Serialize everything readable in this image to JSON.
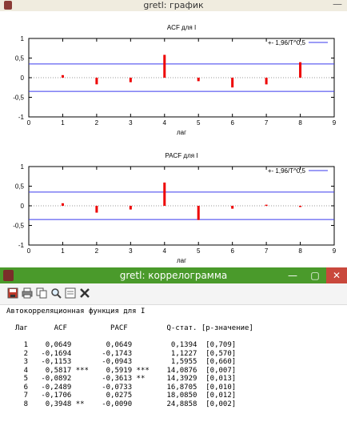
{
  "graph_window": {
    "title": "gretl: график"
  },
  "chart_data": [
    {
      "type": "bar",
      "title": "ACF для I",
      "xlabel": "лаг",
      "ylabel": "",
      "x": [
        1,
        2,
        3,
        4,
        5,
        6,
        7,
        8
      ],
      "values": [
        0.0649,
        -0.1694,
        -0.1153,
        0.5817,
        -0.0892,
        -0.2489,
        -0.1706,
        0.3948
      ],
      "xlim": [
        0,
        9
      ],
      "ylim": [
        -1,
        1
      ],
      "x_ticks": [
        "0",
        "1",
        "2",
        "3",
        "4",
        "5",
        "6",
        "7",
        "8",
        "9"
      ],
      "y_ticks": [
        "1",
        "0,5",
        "0",
        "-0,5",
        "-1"
      ],
      "conf_band": 0.35,
      "legend": "+- 1,96/T^0,5",
      "legend_position": "top-right",
      "bar_color": "#ee0000",
      "band_color": "#3a3aee"
    },
    {
      "type": "bar",
      "title": "PACF для I",
      "xlabel": "лаг",
      "ylabel": "",
      "x": [
        1,
        2,
        3,
        4,
        5,
        6,
        7,
        8
      ],
      "values": [
        0.0649,
        -0.1743,
        -0.0943,
        0.5919,
        -0.3613,
        -0.0733,
        0.0275,
        -0.009
      ],
      "xlim": [
        0,
        9
      ],
      "ylim": [
        -1,
        1
      ],
      "x_ticks": [
        "0",
        "1",
        "2",
        "3",
        "4",
        "5",
        "6",
        "7",
        "8",
        "9"
      ],
      "y_ticks": [
        "1",
        "0,5",
        "0",
        "-0,5",
        "-1"
      ],
      "conf_band": 0.35,
      "legend": "+- 1,96/T^0,5",
      "legend_position": "top-right",
      "bar_color": "#ee0000",
      "band_color": "#3a3aee"
    }
  ],
  "corr_window": {
    "title": "gretl: коррелограмма",
    "toolbar_icons": [
      "save-icon",
      "print-icon",
      "copy-icon",
      "find-icon",
      "edit-icon",
      "close-icon"
    ],
    "heading": "Автокорреляционная функция для I",
    "columns": [
      "Лаг",
      "ACF",
      "PACF",
      "Q-стат.",
      "[p-значение]"
    ],
    "rows": [
      {
        "lag": "1",
        "acf": "0,0649",
        "acf_sig": "",
        "pacf": "0,0649",
        "pacf_sig": "",
        "q": "0,1394",
        "p": "[0,709]"
      },
      {
        "lag": "2",
        "acf": "-0,1694",
        "acf_sig": "",
        "pacf": "-0,1743",
        "pacf_sig": "",
        "q": "1,1227",
        "p": "[0,570]"
      },
      {
        "lag": "3",
        "acf": "-0,1153",
        "acf_sig": "",
        "pacf": "-0,0943",
        "pacf_sig": "",
        "q": "1,5955",
        "p": "[0,660]"
      },
      {
        "lag": "4",
        "acf": "0,5817",
        "acf_sig": "***",
        "pacf": "0,5919",
        "pacf_sig": "***",
        "q": "14,0876",
        "p": "[0,007]"
      },
      {
        "lag": "5",
        "acf": "-0,0892",
        "acf_sig": "",
        "pacf": "-0,3613",
        "pacf_sig": "**",
        "q": "14,3929",
        "p": "[0,013]"
      },
      {
        "lag": "6",
        "acf": "-0,2489",
        "acf_sig": "",
        "pacf": "-0,0733",
        "pacf_sig": "",
        "q": "16,8705",
        "p": "[0,010]"
      },
      {
        "lag": "7",
        "acf": "-0,1706",
        "acf_sig": "",
        "pacf": "0,0275",
        "pacf_sig": "",
        "q": "18,0850",
        "p": "[0,012]"
      },
      {
        "lag": "8",
        "acf": "0,3948",
        "acf_sig": "**",
        "pacf": "-0,0090",
        "pacf_sig": "",
        "q": "24,8858",
        "p": "[0,002]"
      }
    ]
  }
}
